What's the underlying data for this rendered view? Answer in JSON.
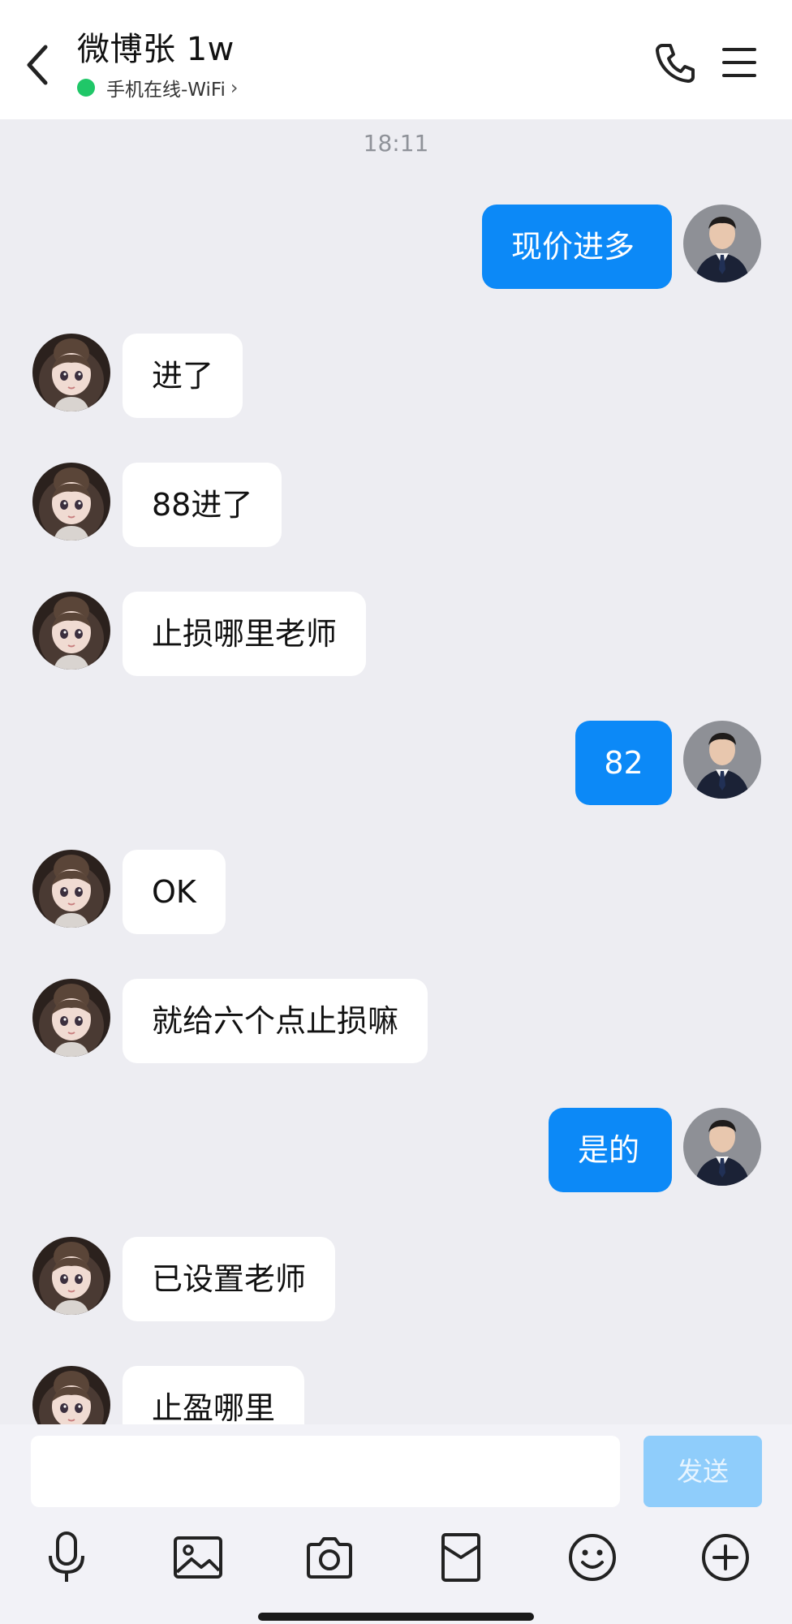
{
  "header": {
    "title": "微博张 1w",
    "status_text": "手机在线-WiFi",
    "status_chevron": "›",
    "online_color": "#20c768",
    "icons": [
      "back-icon",
      "phone-icon",
      "menu-icon"
    ]
  },
  "chat": {
    "timestamp": "18:11",
    "messages": [
      {
        "direction": "out",
        "text": "现价进多"
      },
      {
        "direction": "in",
        "text": "进了"
      },
      {
        "direction": "in",
        "text": "88进了"
      },
      {
        "direction": "in",
        "text": "止损哪里老师"
      },
      {
        "direction": "out",
        "text": "82"
      },
      {
        "direction": "in",
        "text": "OK"
      },
      {
        "direction": "in",
        "text": "就给六个点止损嘛"
      },
      {
        "direction": "out",
        "text": "是的"
      },
      {
        "direction": "in",
        "text": "已设置老师"
      },
      {
        "direction": "in",
        "text": "止盈哪里"
      }
    ]
  },
  "input_bar": {
    "placeholder": "",
    "send_label": "发送",
    "tools": [
      "microphone-icon",
      "image-icon",
      "camera-icon",
      "red-packet-icon",
      "emoji-icon",
      "plus-icon"
    ]
  },
  "colors": {
    "accent": "#0c89f7",
    "send_disabled": "#8fcdfb",
    "chat_bg": "#ededf2"
  }
}
